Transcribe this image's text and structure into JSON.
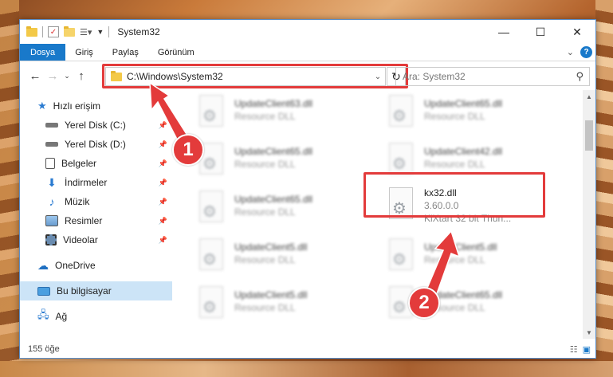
{
  "window": {
    "title": "System32",
    "controls": {
      "minimize": "—",
      "maximize": "☐",
      "close": "✕"
    }
  },
  "ribbon": {
    "tabs": [
      "Dosya",
      "Giriş",
      "Paylaş",
      "Görünüm"
    ]
  },
  "address": {
    "path": "C:\\Windows\\System32",
    "search_placeholder": "Ara: System32"
  },
  "sidebar": {
    "items": [
      {
        "label": "Hızlı erişim",
        "icon": "star-icon"
      },
      {
        "label": "Yerel Disk (C:)",
        "icon": "drive-icon"
      },
      {
        "label": "Yerel Disk (D:)",
        "icon": "drive-icon"
      },
      {
        "label": "Belgeler",
        "icon": "documents-icon"
      },
      {
        "label": "İndirmeler",
        "icon": "download-icon"
      },
      {
        "label": "Müzik",
        "icon": "music-icon"
      },
      {
        "label": "Resimler",
        "icon": "pictures-icon"
      },
      {
        "label": "Videolar",
        "icon": "videos-icon"
      },
      {
        "label": "OneDrive",
        "icon": "cloud-icon"
      },
      {
        "label": "Bu bilgisayar",
        "icon": "computer-icon"
      },
      {
        "label": "Ağ",
        "icon": "network-icon"
      }
    ]
  },
  "files": [
    {
      "name": "UpdateClient63.dll",
      "desc": "Resource DLL"
    },
    {
      "name": "UpdateClient65.dll",
      "desc": "Resource DLL"
    },
    {
      "name": "UpdateClient65.dll",
      "desc": "Resource DLL"
    },
    {
      "name": "UpdateClient42.dll",
      "desc": "Resource DLL"
    },
    {
      "name": "UpdateClient65.dll",
      "desc": "Resource DLL"
    },
    {
      "name": "kx32.dll",
      "version": "3.60.0.0",
      "desc": "KiXtart 32 bit Thun..."
    },
    {
      "name": "UpdateClient5.dll",
      "desc": "Resource DLL"
    },
    {
      "name": "UpdateClient5.dll",
      "desc": "Resource DLL"
    },
    {
      "name": "UpdateClient5.dll",
      "desc": "Resource DLL"
    },
    {
      "name": "UpdateClient65.dll",
      "desc": "Resource DLL"
    }
  ],
  "status": {
    "count": "155 öğe"
  },
  "callouts": [
    "1",
    "2"
  ],
  "colors": {
    "accent": "#1979ca",
    "highlight": "#e33b3b",
    "selected": "#cce4f7"
  }
}
